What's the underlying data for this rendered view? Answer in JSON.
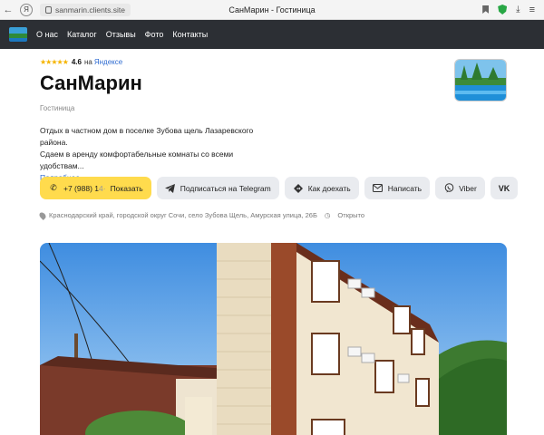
{
  "browser": {
    "url": "sanmarin.clients.site",
    "page_title": "СанМарин - Гостиница"
  },
  "nav": {
    "items": [
      "О нас",
      "Каталог",
      "Отзывы",
      "Фото",
      "Контакты"
    ]
  },
  "rating": {
    "stars": "★★★★★",
    "value": "4.6",
    "on": "на",
    "source": "Яндексе"
  },
  "business": {
    "name": "СанМарин",
    "category": "Гостиница",
    "description_line1": "Отдых в частном дом в поселке Зубова щель Лазаревского района.",
    "description_line2": "Сдаем в аренду комфортабельные комнаты со всеми удобствам...",
    "more_label": "Подробнее"
  },
  "actions": {
    "phone_prefix": "+7 (988) 1",
    "phone_masked": "4·",
    "phone_show": "Показать",
    "telegram": "Подписаться на Telegram",
    "directions": "Как доехать",
    "write": "Написать",
    "viber": "Viber",
    "vk": "VK"
  },
  "address": {
    "text": "Краснодарский край, городской округ Сочи, село Зубова Щель, Амурская улица, 26Б",
    "status": "Открыто"
  },
  "colors": {
    "nav_bg": "#2c2f34",
    "phone_button": "#ffdb4d",
    "link": "#2e6bd1",
    "star": "#f5b400"
  }
}
